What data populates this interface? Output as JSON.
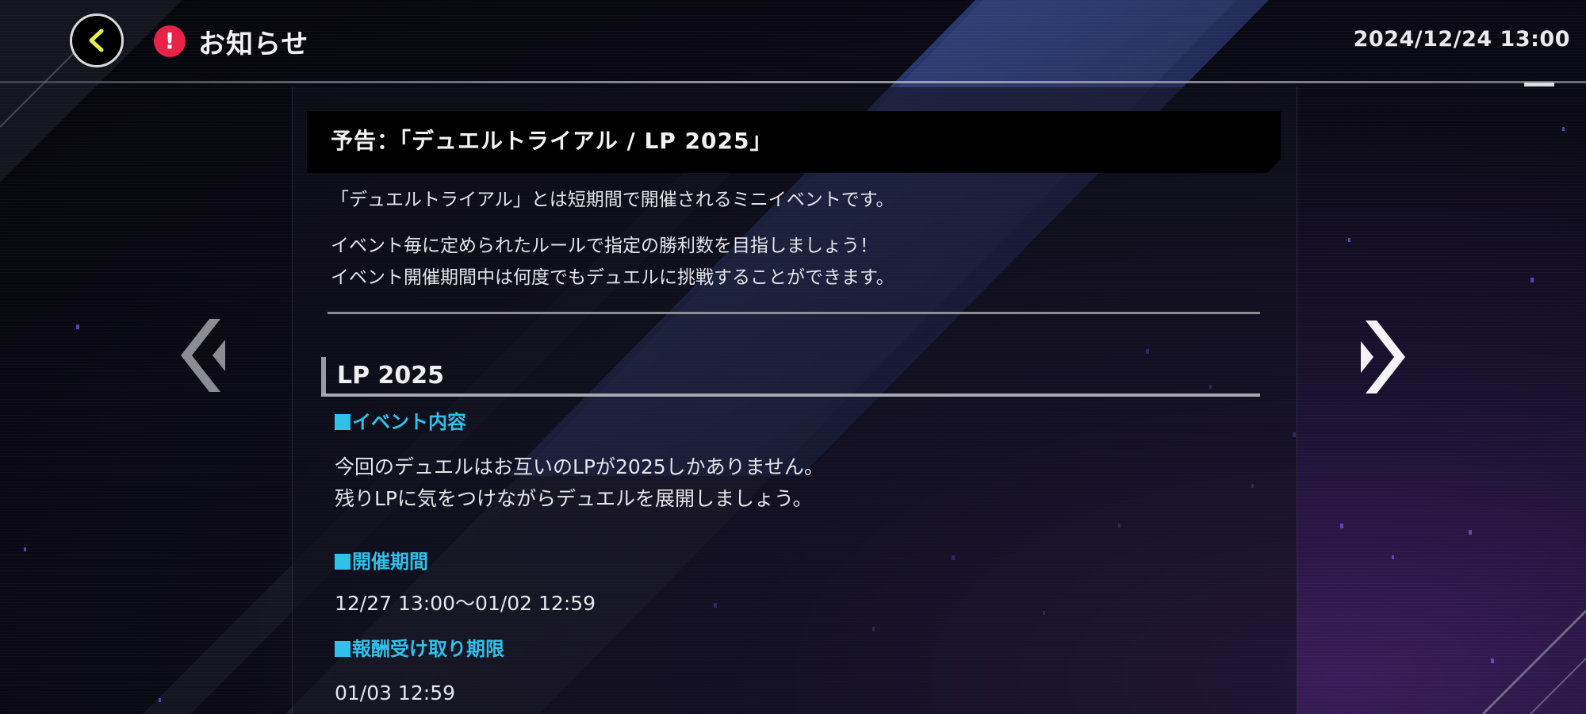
{
  "header": {
    "title": "お知らせ",
    "datetime": "2024/12/24 13:00",
    "notice_mark": "!"
  },
  "icons": {
    "back": "back-chevron-icon",
    "notice": "exclamation-icon",
    "prev": "double-chevron-left-icon",
    "next": "double-chevron-right-icon"
  },
  "colors": {
    "accent_cyan": "#2fc1ea",
    "notice_red": "#e8234a",
    "back_arrow": "#e6f04a"
  },
  "notice": {
    "title": "予告：「デュエルトライアル / LP 2025」",
    "intro": "「デュエルトライアル」とは短期間で開催されるミニイベントです。",
    "description_line1": "イベント毎に定められたルールで指定の勝利数を目指しましょう！",
    "description_line2": "イベント開催期間中は何度でもデュエルに挑戦することができます。",
    "section_title": "LP 2025",
    "event_content_label": "イベント内容",
    "event_content_line1": "今回のデュエルはお互いのLPが2025しかありません。",
    "event_content_line2": "残りLPに気をつけながらデュエルを展開しましょう。",
    "period_label": "開催期間",
    "period_value": "12/27 13:00～01/02 12:59",
    "reward_deadline_label": "報酬受け取り期限",
    "reward_deadline_value": "01/03 12:59"
  }
}
